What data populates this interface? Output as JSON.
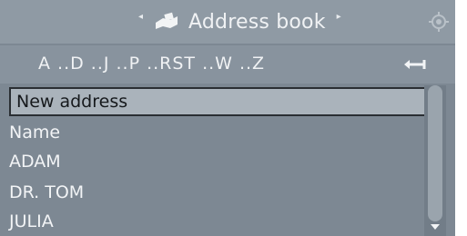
{
  "header": {
    "title": "Address book",
    "left_arrow": "◂",
    "right_arrow": "▸"
  },
  "alphabet": {
    "text": "A ..D ..J ..P ..RST ..W ..Z"
  },
  "list": {
    "items": [
      {
        "label": "New address",
        "selected": true
      },
      {
        "label": "Name",
        "selected": false
      },
      {
        "label": "ADAM",
        "selected": false
      },
      {
        "label": "DR. TOM",
        "selected": false
      },
      {
        "label": "JULIA",
        "selected": false
      }
    ]
  },
  "icons": {
    "title_icon": "address-book-icon",
    "corner_icon": "controller-icon",
    "back_icon": "back-arrow-icon",
    "scroll_icon": "chevron-down-icon"
  },
  "colors": {
    "background": "#7d8893",
    "titlebar": "#8f9aa4",
    "selection": "#aab3bb",
    "text": "#f2f4f6"
  }
}
